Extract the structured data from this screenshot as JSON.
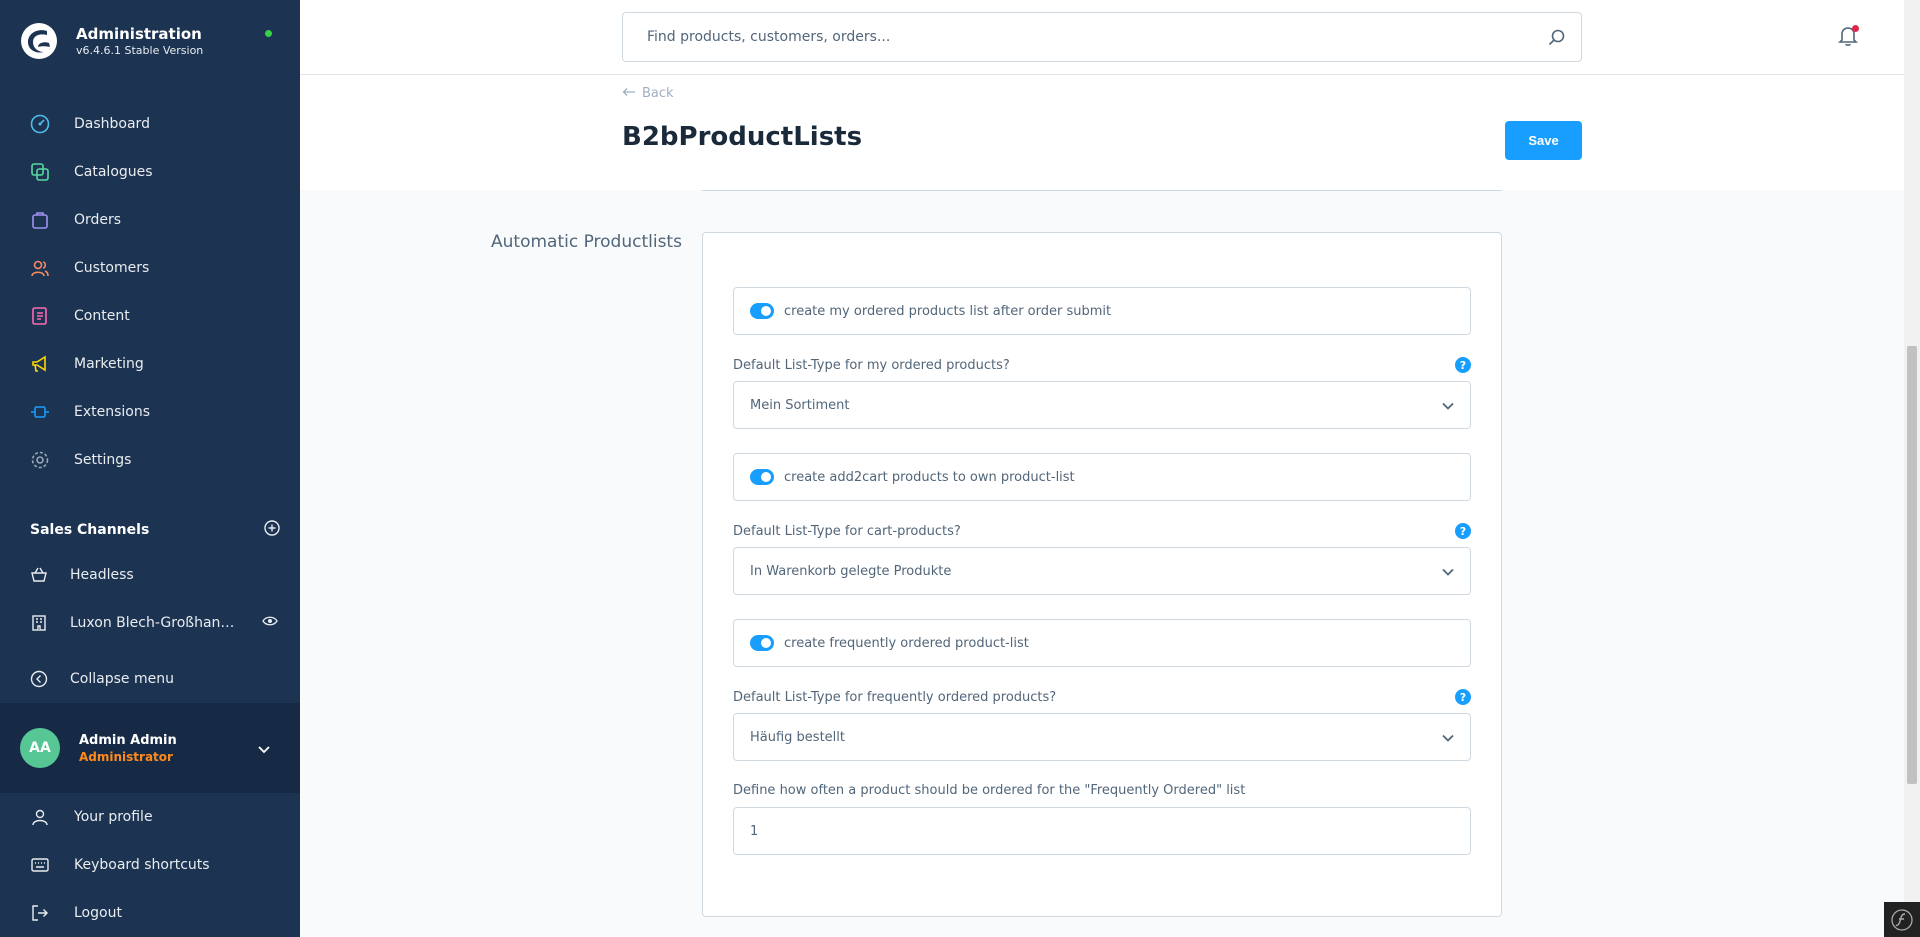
{
  "app": {
    "title": "Administration",
    "version": "v6.4.6.1 Stable Version",
    "colors": {
      "sidebar": "#1d3352",
      "accent": "#189eff",
      "role": "#ff8a1c",
      "avatar": "#56c794"
    }
  },
  "nav": {
    "items": [
      {
        "label": "Dashboard",
        "icon": "dashboard-icon"
      },
      {
        "label": "Catalogues",
        "icon": "catalogues-icon"
      },
      {
        "label": "Orders",
        "icon": "orders-icon"
      },
      {
        "label": "Customers",
        "icon": "customers-icon"
      },
      {
        "label": "Content",
        "icon": "content-icon"
      },
      {
        "label": "Marketing",
        "icon": "marketing-icon"
      },
      {
        "label": "Extensions",
        "icon": "extensions-icon"
      },
      {
        "label": "Settings",
        "icon": "settings-icon"
      }
    ]
  },
  "sales_channels": {
    "title": "Sales Channels",
    "items": [
      {
        "label": "Headless",
        "icon": "basket-icon"
      },
      {
        "label": "Luxon Blech-Großhandel ...",
        "icon": "storefront-icon"
      }
    ],
    "collapse_label": "Collapse menu"
  },
  "user": {
    "initials": "AA",
    "name": "Admin Admin",
    "role": "Administrator"
  },
  "user_menu": {
    "profile": "Your profile",
    "shortcuts": "Keyboard shortcuts",
    "logout": "Logout"
  },
  "search": {
    "placeholder": "Find products, customers, orders..."
  },
  "page": {
    "back_label": "Back",
    "title": "B2bProductLists",
    "save_label": "Save"
  },
  "section": {
    "title": "Automatic Productlists",
    "toggle_1": {
      "label": "create my ordered products list after order submit",
      "on": true
    },
    "field_1_label": "Default List-Type for my ordered products?",
    "field_1_value": "Mein Sortiment",
    "toggle_2": {
      "label": "create add2cart products to own product-list",
      "on": true
    },
    "field_2_label": "Default List-Type for cart-products?",
    "field_2_value": "In Warenkorb gelegte Produkte",
    "toggle_3": {
      "label": "create frequently ordered product-list",
      "on": true
    },
    "field_3_label": "Default List-Type for frequently ordered products?",
    "field_3_value": "Häufig bestellt",
    "field_4_label": "Define how often a product should be ordered for the \"Frequently Ordered\" list",
    "field_4_value": "1"
  }
}
